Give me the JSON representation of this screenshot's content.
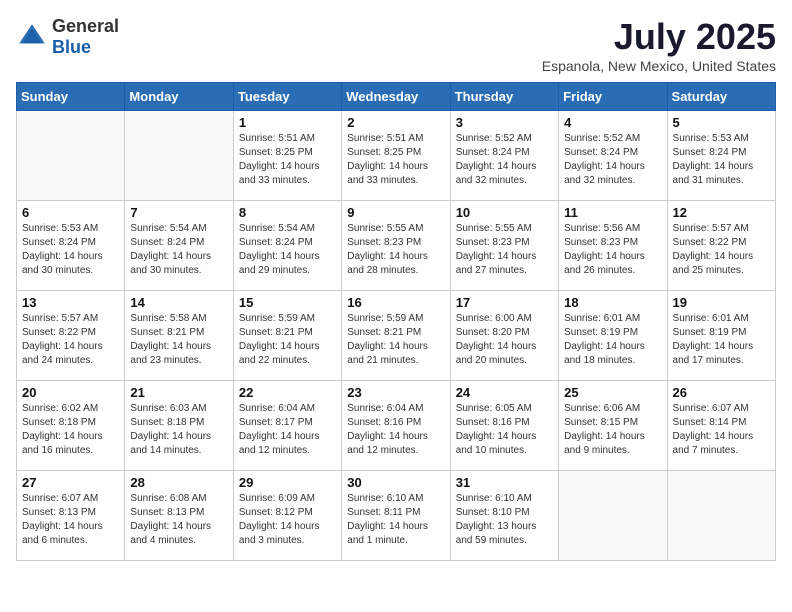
{
  "header": {
    "logo_general": "General",
    "logo_blue": "Blue",
    "title": "July 2025",
    "subtitle": "Espanola, New Mexico, United States"
  },
  "days_of_week": [
    "Sunday",
    "Monday",
    "Tuesday",
    "Wednesday",
    "Thursday",
    "Friday",
    "Saturday"
  ],
  "weeks": [
    [
      {
        "day": "",
        "content": ""
      },
      {
        "day": "",
        "content": ""
      },
      {
        "day": "1",
        "content": "Sunrise: 5:51 AM\nSunset: 8:25 PM\nDaylight: 14 hours and 33 minutes."
      },
      {
        "day": "2",
        "content": "Sunrise: 5:51 AM\nSunset: 8:25 PM\nDaylight: 14 hours and 33 minutes."
      },
      {
        "day": "3",
        "content": "Sunrise: 5:52 AM\nSunset: 8:24 PM\nDaylight: 14 hours and 32 minutes."
      },
      {
        "day": "4",
        "content": "Sunrise: 5:52 AM\nSunset: 8:24 PM\nDaylight: 14 hours and 32 minutes."
      },
      {
        "day": "5",
        "content": "Sunrise: 5:53 AM\nSunset: 8:24 PM\nDaylight: 14 hours and 31 minutes."
      }
    ],
    [
      {
        "day": "6",
        "content": "Sunrise: 5:53 AM\nSunset: 8:24 PM\nDaylight: 14 hours and 30 minutes."
      },
      {
        "day": "7",
        "content": "Sunrise: 5:54 AM\nSunset: 8:24 PM\nDaylight: 14 hours and 30 minutes."
      },
      {
        "day": "8",
        "content": "Sunrise: 5:54 AM\nSunset: 8:24 PM\nDaylight: 14 hours and 29 minutes."
      },
      {
        "day": "9",
        "content": "Sunrise: 5:55 AM\nSunset: 8:23 PM\nDaylight: 14 hours and 28 minutes."
      },
      {
        "day": "10",
        "content": "Sunrise: 5:55 AM\nSunset: 8:23 PM\nDaylight: 14 hours and 27 minutes."
      },
      {
        "day": "11",
        "content": "Sunrise: 5:56 AM\nSunset: 8:23 PM\nDaylight: 14 hours and 26 minutes."
      },
      {
        "day": "12",
        "content": "Sunrise: 5:57 AM\nSunset: 8:22 PM\nDaylight: 14 hours and 25 minutes."
      }
    ],
    [
      {
        "day": "13",
        "content": "Sunrise: 5:57 AM\nSunset: 8:22 PM\nDaylight: 14 hours and 24 minutes."
      },
      {
        "day": "14",
        "content": "Sunrise: 5:58 AM\nSunset: 8:21 PM\nDaylight: 14 hours and 23 minutes."
      },
      {
        "day": "15",
        "content": "Sunrise: 5:59 AM\nSunset: 8:21 PM\nDaylight: 14 hours and 22 minutes."
      },
      {
        "day": "16",
        "content": "Sunrise: 5:59 AM\nSunset: 8:21 PM\nDaylight: 14 hours and 21 minutes."
      },
      {
        "day": "17",
        "content": "Sunrise: 6:00 AM\nSunset: 8:20 PM\nDaylight: 14 hours and 20 minutes."
      },
      {
        "day": "18",
        "content": "Sunrise: 6:01 AM\nSunset: 8:19 PM\nDaylight: 14 hours and 18 minutes."
      },
      {
        "day": "19",
        "content": "Sunrise: 6:01 AM\nSunset: 8:19 PM\nDaylight: 14 hours and 17 minutes."
      }
    ],
    [
      {
        "day": "20",
        "content": "Sunrise: 6:02 AM\nSunset: 8:18 PM\nDaylight: 14 hours and 16 minutes."
      },
      {
        "day": "21",
        "content": "Sunrise: 6:03 AM\nSunset: 8:18 PM\nDaylight: 14 hours and 14 minutes."
      },
      {
        "day": "22",
        "content": "Sunrise: 6:04 AM\nSunset: 8:17 PM\nDaylight: 14 hours and 12 minutes."
      },
      {
        "day": "23",
        "content": "Sunrise: 6:04 AM\nSunset: 8:16 PM\nDaylight: 14 hours and 12 minutes."
      },
      {
        "day": "24",
        "content": "Sunrise: 6:05 AM\nSunset: 8:16 PM\nDaylight: 14 hours and 10 minutes."
      },
      {
        "day": "25",
        "content": "Sunrise: 6:06 AM\nSunset: 8:15 PM\nDaylight: 14 hours and 9 minutes."
      },
      {
        "day": "26",
        "content": "Sunrise: 6:07 AM\nSunset: 8:14 PM\nDaylight: 14 hours and 7 minutes."
      }
    ],
    [
      {
        "day": "27",
        "content": "Sunrise: 6:07 AM\nSunset: 8:13 PM\nDaylight: 14 hours and 6 minutes."
      },
      {
        "day": "28",
        "content": "Sunrise: 6:08 AM\nSunset: 8:13 PM\nDaylight: 14 hours and 4 minutes."
      },
      {
        "day": "29",
        "content": "Sunrise: 6:09 AM\nSunset: 8:12 PM\nDaylight: 14 hours and 3 minutes."
      },
      {
        "day": "30",
        "content": "Sunrise: 6:10 AM\nSunset: 8:11 PM\nDaylight: 14 hours and 1 minute."
      },
      {
        "day": "31",
        "content": "Sunrise: 6:10 AM\nSunset: 8:10 PM\nDaylight: 13 hours and 59 minutes."
      },
      {
        "day": "",
        "content": ""
      },
      {
        "day": "",
        "content": ""
      }
    ]
  ]
}
